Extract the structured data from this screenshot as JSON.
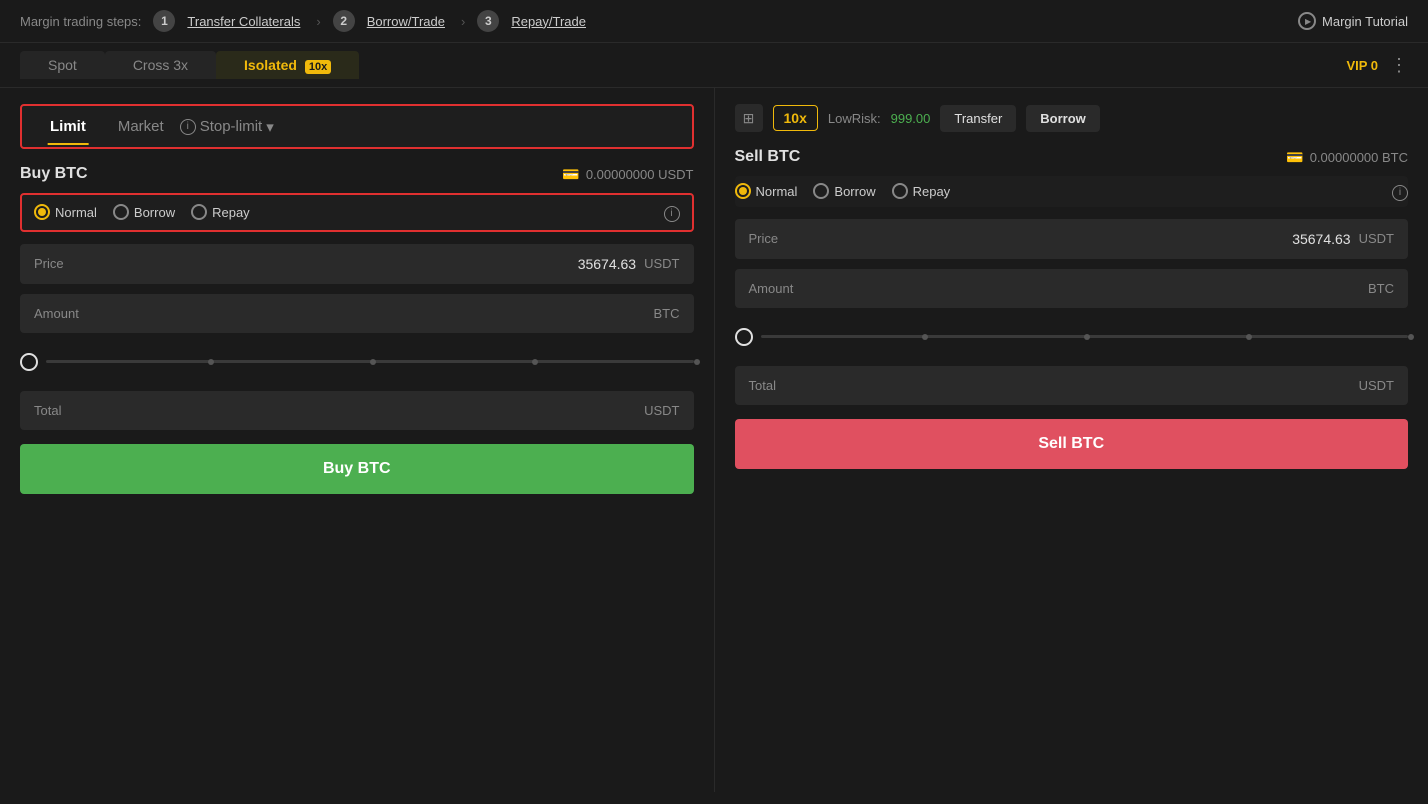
{
  "topBar": {
    "stepsLabel": "Margin trading steps:",
    "step1Num": "1",
    "step1Label": "Transfer Collaterals",
    "step2Num": "2",
    "step2Label": "Borrow/Trade",
    "step3Num": "3",
    "step3Label": "Repay/Trade",
    "tutorialLabel": "Margin Tutorial"
  },
  "tabs": {
    "spot": "Spot",
    "cross": "Cross 3x",
    "isolated": "Isolated",
    "isolatedLeverage": "10x",
    "vip": "VIP 0"
  },
  "rightControls": {
    "leverage": "10x",
    "lowRiskLabel": "LowRisk:",
    "lowRiskValue": "999.00",
    "transferLabel": "Transfer",
    "borrowLabel": "Borrow"
  },
  "orderTypes": {
    "limit": "Limit",
    "market": "Market",
    "stopLimit": "Stop-limit"
  },
  "buyPanel": {
    "sideLabel": "Buy BTC",
    "walletBalance": "0.00000000 USDT",
    "radioNormal": "Normal",
    "radioBorrow": "Borrow",
    "radioRepay": "Repay",
    "priceLabel": "Price",
    "priceValue": "35674.63",
    "priceUnit": "USDT",
    "amountLabel": "Amount",
    "amountUnit": "BTC",
    "totalLabel": "Total",
    "totalUnit": "USDT",
    "buyBtnLabel": "Buy BTC"
  },
  "sellPanel": {
    "sideLabel": "Sell BTC",
    "walletBalance": "0.00000000 BTC",
    "radioNormal": "Normal",
    "radioBorrow": "Borrow",
    "radioRepay": "Repay",
    "priceLabel": "Price",
    "priceValue": "35674.63",
    "priceUnit": "USDT",
    "amountLabel": "Amount",
    "amountUnit": "BTC",
    "totalLabel": "Total",
    "totalUnit": "USDT",
    "sellBtnLabel": "Sell BTC"
  },
  "icons": {
    "wallet": "💳",
    "calculator": "⊞",
    "info": "i",
    "play": "▶"
  }
}
